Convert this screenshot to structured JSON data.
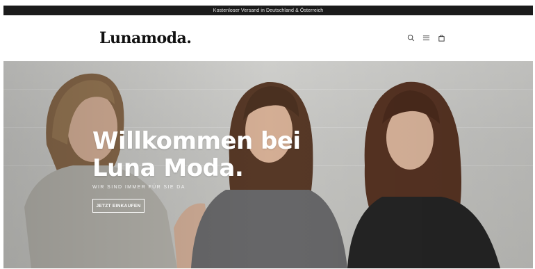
{
  "announcement": {
    "text": "Kostenloser Versand in Deutschland & Österreich"
  },
  "header": {
    "logo": "Lunamoda.",
    "icons": [
      "search-icon",
      "menu-icon",
      "bag-icon"
    ]
  },
  "hero": {
    "title_line1": "Willkommen bei",
    "title_line2": "Luna Moda.",
    "subtitle": "WIR SIND IMMER FÜR SIE DA",
    "button_label": "JETZT EINKAUFEN"
  },
  "colors": {
    "announcement_bg": "#1b1b1b",
    "hero_text": "#ffffff"
  }
}
